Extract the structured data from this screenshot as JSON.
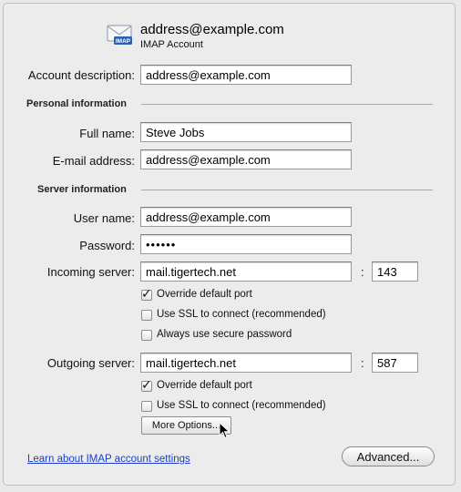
{
  "header": {
    "icon": "imap-mail-envelope-icon",
    "icon_badge": "IMAP",
    "title": "address@example.com",
    "subtitle": "IMAP Account"
  },
  "account": {
    "description_label": "Account description:",
    "description_value": "address@example.com"
  },
  "personal": {
    "section_label": "Personal information",
    "full_name_label": "Full name:",
    "full_name_value": "Steve Jobs",
    "email_label": "E-mail address:",
    "email_value": "address@example.com"
  },
  "server": {
    "section_label": "Server information",
    "username_label": "User name:",
    "username_value": "address@example.com",
    "password_label": "Password:",
    "password_value": "••••••",
    "incoming": {
      "label": "Incoming server:",
      "host": "mail.tigertech.net",
      "colon": ":",
      "port": "143",
      "override_label": "Override default port",
      "override_checked": true,
      "ssl_label": "Use SSL to connect (recommended)",
      "ssl_checked": false,
      "secure_pw_label": "Always use secure password",
      "secure_pw_checked": false
    },
    "outgoing": {
      "label": "Outgoing server:",
      "host": "mail.tigertech.net",
      "colon": ":",
      "port": "587",
      "override_label": "Override default port",
      "override_checked": true,
      "ssl_label": "Use SSL to connect (recommended)",
      "ssl_checked": false
    },
    "more_options_label": "More Options..."
  },
  "footer": {
    "learn_link": "Learn about IMAP account settings",
    "advanced_label": "Advanced..."
  },
  "colors": {
    "window_bg": "#ececec",
    "link": "#1a3fd0",
    "field_border": "#9a9a9a"
  }
}
